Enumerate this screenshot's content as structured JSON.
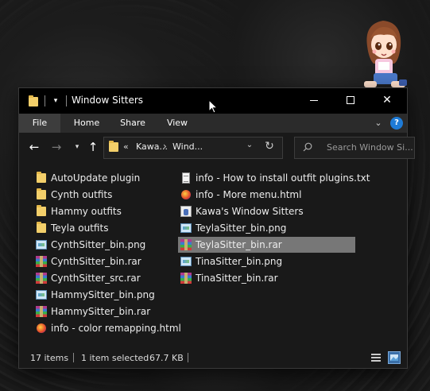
{
  "window": {
    "title": "Window Sitters",
    "minimize_glyph": "—",
    "maximize_glyph": "☐",
    "close_glyph": "✕"
  },
  "ribbon": {
    "tabs": [
      {
        "label": "File"
      },
      {
        "label": "Home"
      },
      {
        "label": "Share"
      },
      {
        "label": "View"
      }
    ],
    "help_label": "?"
  },
  "address": {
    "overflow": "«",
    "crumbs": [
      "Kawa...",
      "Wind..."
    ],
    "separator": "›",
    "search_placeholder": "Search Window Si..."
  },
  "files": {
    "column1": [
      {
        "name": "AutoUpdate plugin",
        "icon": "folder-icon"
      },
      {
        "name": "Cynth outfits",
        "icon": "folder-icon"
      },
      {
        "name": "Hammy outfits",
        "icon": "folder-icon"
      },
      {
        "name": "Teyla outfits",
        "icon": "folder-icon"
      },
      {
        "name": "CynthSitter_bin.png",
        "icon": "png-file-icon"
      },
      {
        "name": "CynthSitter_bin.rar",
        "icon": "rar-archive-icon"
      },
      {
        "name": "CynthSitter_src.rar",
        "icon": "rar-archive-icon"
      },
      {
        "name": "HammySitter_bin.png",
        "icon": "png-file-icon"
      },
      {
        "name": "HammySitter_bin.rar",
        "icon": "rar-archive-icon"
      },
      {
        "name": "info - color remapping.html",
        "icon": "html-file-icon"
      }
    ],
    "column2": [
      {
        "name": "info - How to install outfit plugins.txt",
        "icon": "text-file-icon"
      },
      {
        "name": "info - More menu.html",
        "icon": "html-file-icon"
      },
      {
        "name": "Kawa's Window Sitters",
        "icon": "application-icon"
      },
      {
        "name": "TeylaSitter_bin.png",
        "icon": "png-file-icon"
      },
      {
        "name": "TeylaSitter_bin.rar",
        "icon": "rar-archive-icon",
        "selected": true
      },
      {
        "name": "TinaSitter_bin.png",
        "icon": "png-file-icon"
      },
      {
        "name": "TinaSitter_bin.rar",
        "icon": "rar-archive-icon"
      }
    ]
  },
  "status": {
    "item_count": "17 items",
    "selection": "1 item selected",
    "size": "67.7 KB"
  },
  "colors": {
    "titlebar": "#000000",
    "ribbon": "#2b2b2b",
    "content": "#191919",
    "selection": "#777777",
    "help_accent": "#1e7bd7"
  }
}
